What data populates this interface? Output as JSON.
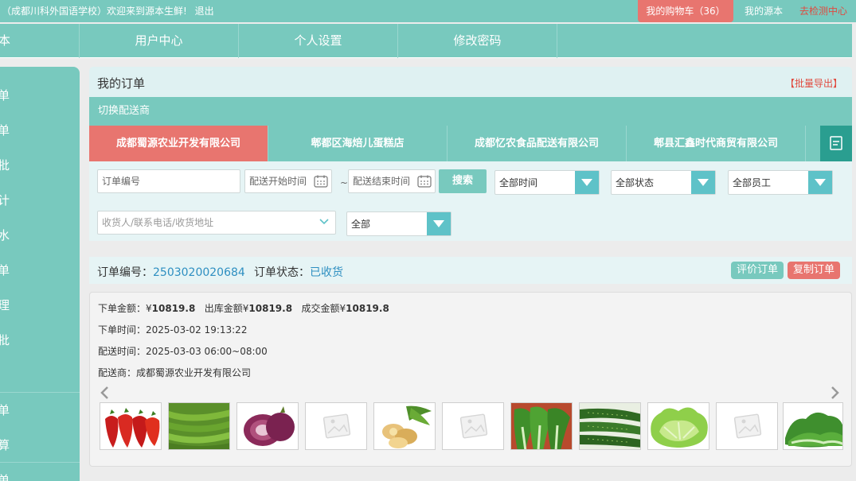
{
  "topbar": {
    "welcome": "：（成都川科外国语学校）欢迎来到源本生鲜!",
    "logout": "退出",
    "cart": "我的购物车（36）",
    "my_yuanben": "我的源本",
    "goto_check": "去检测中心"
  },
  "nav": {
    "items": [
      "本",
      "用户中心",
      "个人设置",
      "修改密码"
    ]
  },
  "sidebar": {
    "items": [
      "单",
      "单",
      "批",
      "计",
      "水",
      "单",
      "理",
      "批",
      "",
      "单",
      "算",
      "单"
    ]
  },
  "panel": {
    "title": "我的订单",
    "export": "【批量导出】",
    "switch_label": "切换配送商"
  },
  "suppliers": [
    "成都蜀源农业开发有限公司",
    "郫都区海焙儿蛋糕店",
    "成都忆农食品配送有限公司",
    "郫县汇鑫时代商贸有限公司"
  ],
  "filters": {
    "order_no_placeholder": "订单编号",
    "start_placeholder": "配送开始时间",
    "end_placeholder": "配送结束时间",
    "tilde": "~",
    "search": "搜索",
    "time_select": "全部时间",
    "status_select": "全部状态",
    "staff_select": "全部员工",
    "receiver_placeholder": "收货人/联系电话/收货地址",
    "all_select": "全部"
  },
  "order": {
    "no_label": "订单编号：",
    "no_value": "2503020020684",
    "status_label": "订单状态：",
    "status_value": "已收货",
    "rate_btn": "评价订单",
    "copy_btn": "复制订单",
    "amount_label1": "下单金额：¥",
    "amount_value1": "10819.8",
    "amount_label2": "出库金额¥",
    "amount_value2": "10819.8",
    "amount_label3": "成交金额¥",
    "amount_value3": "10819.8",
    "order_time": "下单时间：2025-03-02 19:13:22",
    "delivery_time": "配送时间：2025-03-03 06:00~08:00",
    "supplier": "配送商：成都蜀源农业开发有限公司"
  },
  "products": [
    "red-pepper-icon",
    "green-pepper-icon",
    "red-onion-icon",
    "placeholder-image-icon",
    "ginger-icon",
    "placeholder-image-icon",
    "bok-choy-icon",
    "cucumber-icon",
    "lettuce-icon",
    "placeholder-image-icon",
    "greens-icon"
  ],
  "colors": {
    "teal": "#78c9be",
    "coral": "#e8756f",
    "link_blue": "#2e8fc1",
    "red_text": "#e04a3f"
  }
}
